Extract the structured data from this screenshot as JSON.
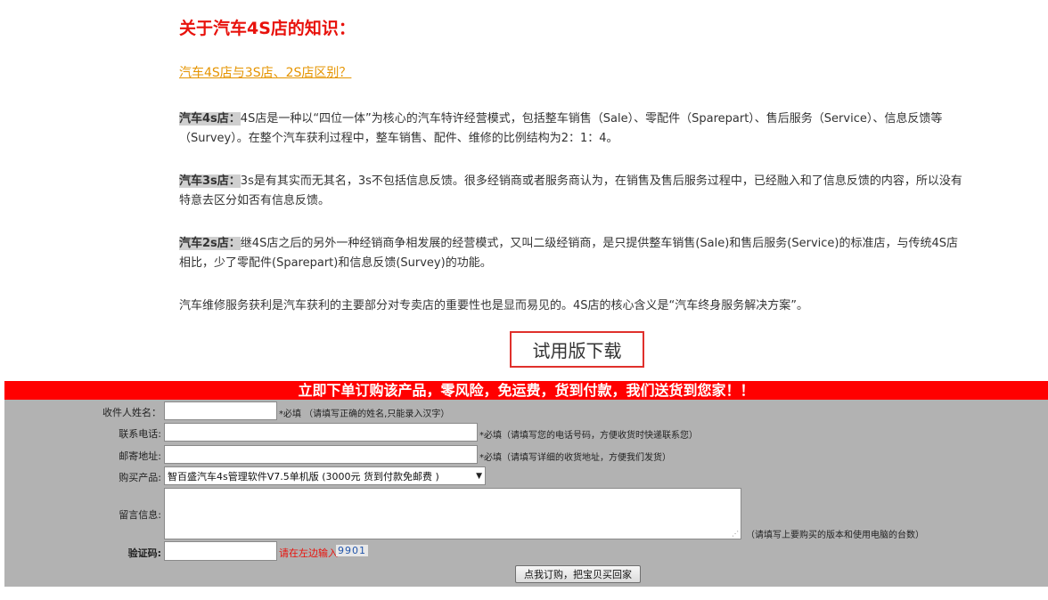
{
  "article": {
    "title": "关于汽车4S店的知识：",
    "link_text": "汽车4S店与3S店、2S店区别？",
    "paragraphs": [
      {
        "label": "汽车4s店：",
        "text": "4S店是一种以“四位一体”为核心的汽车特许经营模式，包括整车销售（Sale）、零配件（Sparepart）、售后服务（Service）、信息反馈等（Survey）。在整个汽车获利过程中，整车销售、配件、维修的比例结构为2：1：4。"
      },
      {
        "label": "汽车3s店：",
        "text": "3s是有其实而无其名，3s不包括信息反馈。很多经销商或者服务商认为，在销售及售后服务过程中，已经融入和了信息反馈的内容，所以没有特意去区分如否有信息反馈。"
      },
      {
        "label": "汽车2s店：",
        "text": "继4S店之后的另外一种经销商争相发展的经营模式，又叫二级经销商，是只提供整车销售(Sale)和售后服务(Service)的标准店，与传统4S店相比，少了零配件(Sparepart)和信息反馈(Survey)的功能。"
      },
      {
        "label": "",
        "text": "汽车维修服务获利是汽车获利的主要部分对专卖店的重要性也是显而易见的。4S店的核心含义是“汽车终身服务解决方案”。"
      }
    ],
    "download_button": "试用版下载"
  },
  "order": {
    "banner": "立即下单订购该产品，零风险，免运费，货到付款，我们送货到您家！！",
    "name_label": "收件人姓名：",
    "name_value": "",
    "name_hint": "*必填 （请填写正确的姓名,只能录入汉字）",
    "phone_label": "联系电话:",
    "phone_value": "",
    "phone_hint": "*必填（请填写您的电话号码，方便收货时快递联系您）",
    "address_label": "邮寄地址:",
    "address_value": "",
    "address_hint": "*必填（请填写详细的收货地址，方便我们发货）",
    "product_label": "购买产品:",
    "product_selected": "智百盛汽车4s管理软件V7.5单机版 (3000元 货到付款免邮费 )",
    "message_label": "留言信息:",
    "message_value": "",
    "message_hint": "（请填写上要购买的版本和使用电脑的台数）",
    "captcha_label": "验证码:",
    "captcha_value": "",
    "captcha_hint": "请在左边输入",
    "captcha_code": "9901",
    "submit_label": "点我订购，把宝贝买回家"
  },
  "icons": {
    "select_caret": "chevron-down-icon",
    "resize_grip": "resize-grip-icon"
  },
  "colors": {
    "title_red": "#e8120c",
    "link_orange": "#e59400",
    "banner_red": "#ff0000",
    "form_gray": "#b2b2b2"
  }
}
